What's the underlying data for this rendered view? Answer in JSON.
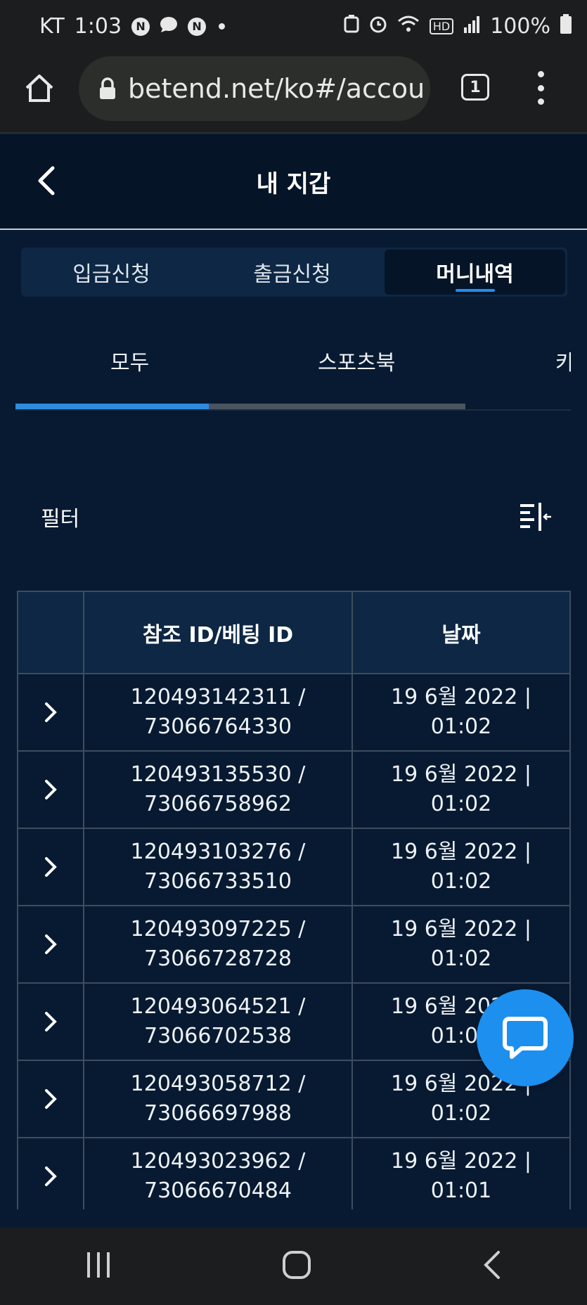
{
  "status_bar": {
    "carrier": "KT",
    "time": "1:03",
    "notif_badges": [
      "N",
      "N"
    ],
    "network": "HD",
    "battery": "100%"
  },
  "browser": {
    "url": "betend.net/ko#/accou",
    "tab_count": "1"
  },
  "header": {
    "title": "내 지갑"
  },
  "segment_tabs": [
    {
      "label": "입금신청",
      "active": false
    },
    {
      "label": "출금신청",
      "active": false
    },
    {
      "label": "머니내역",
      "active": true
    }
  ],
  "sub_tabs": [
    {
      "label": "모두"
    },
    {
      "label": "스포츠북"
    },
    {
      "label": "카"
    }
  ],
  "scroll_progress": 0.43,
  "scroll_track_fraction": 0.81,
  "filter": {
    "label": "필터"
  },
  "table": {
    "headers": [
      "",
      "참조 ID/베팅 ID",
      "날짜"
    ],
    "rows": [
      {
        "ref_line1": "120493142311 /",
        "ref_line2": "73066764330",
        "date_line1": "19 6월 2022 |",
        "date_line2": "01:02"
      },
      {
        "ref_line1": "120493135530 /",
        "ref_line2": "73066758962",
        "date_line1": "19 6월 2022 |",
        "date_line2": "01:02"
      },
      {
        "ref_line1": "120493103276 /",
        "ref_line2": "73066733510",
        "date_line1": "19 6월 2022 |",
        "date_line2": "01:02"
      },
      {
        "ref_line1": "120493097225 /",
        "ref_line2": "73066728728",
        "date_line1": "19 6월 2022 |",
        "date_line2": "01:02"
      },
      {
        "ref_line1": "120493064521 /",
        "ref_line2": "73066702538",
        "date_line1": "19 6월 2022 |",
        "date_line2": "01:02"
      },
      {
        "ref_line1": "120493058712 /",
        "ref_line2": "73066697988",
        "date_line1": "19 6월 2022 |",
        "date_line2": "01:02"
      },
      {
        "ref_line1": "120493023962 /",
        "ref_line2": "73066670484",
        "date_line1": "19 6월 2022 |",
        "date_line2": "01:01"
      }
    ]
  },
  "icons": {
    "home": "home-icon",
    "lock": "lock-icon",
    "back": "chevron-left-icon",
    "filter": "filter-icon",
    "expand": "chevron-right-icon",
    "chat": "chat-icon"
  },
  "colors": {
    "background": "#081a31",
    "header": "#061427",
    "accent": "#1e8ff0",
    "table_header": "#0d2744"
  }
}
